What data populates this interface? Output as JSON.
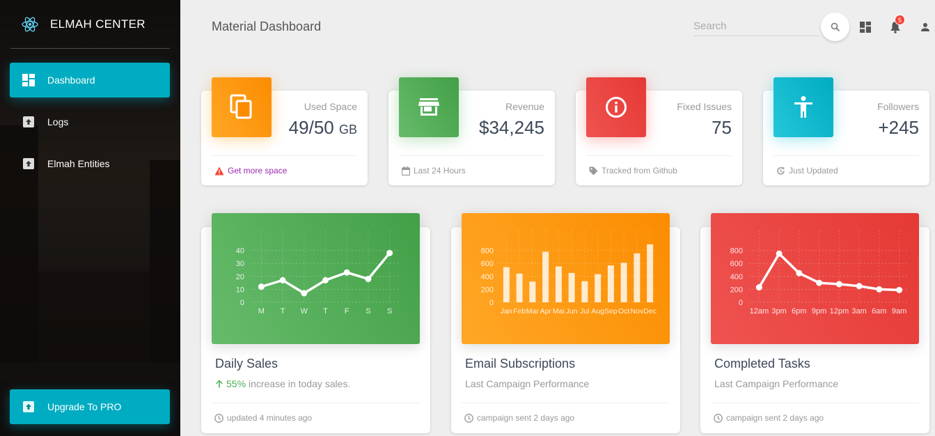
{
  "sidebar": {
    "brand": "ELMAH CENTER",
    "items": [
      {
        "label": "Dashboard",
        "icon": "dashboard-icon"
      },
      {
        "label": "Logs",
        "icon": "upload-box-icon"
      },
      {
        "label": "Elmah Entities",
        "icon": "upload-box-icon"
      }
    ],
    "upgrade_label": "Upgrade To PRO",
    "accent": "#00acc1"
  },
  "topbar": {
    "title": "Material Dashboard",
    "search_placeholder": "Search",
    "notification_count": "5"
  },
  "stats": [
    {
      "category": "Used Space",
      "value": "49/50",
      "unit": "GB",
      "footer": "Get more space",
      "footer_icon": "warning-icon",
      "color": "#fb8c00",
      "icon": "content-copy-icon"
    },
    {
      "category": "Revenue",
      "value": "$34,245",
      "footer": "Last 24 Hours",
      "footer_icon": "calendar-icon",
      "color": "#43a047",
      "icon": "store-icon"
    },
    {
      "category": "Fixed Issues",
      "value": "75",
      "footer": "Tracked from Github",
      "footer_icon": "tag-icon",
      "color": "#e53935",
      "icon": "info-icon"
    },
    {
      "category": "Followers",
      "value": "+245",
      "footer": "Just Updated",
      "footer_icon": "update-icon",
      "color": "#00acc1",
      "icon": "accessibility-icon"
    }
  ],
  "cards": [
    {
      "title": "Daily Sales",
      "subtitle_highlight": "55%",
      "subtitle": "increase in today sales.",
      "footer": "updated 4 minutes ago",
      "color": "#4caf50"
    },
    {
      "title": "Email Subscriptions",
      "subtitle": "Last Campaign Performance",
      "footer": "campaign sent 2 days ago",
      "color": "#ff9800"
    },
    {
      "title": "Completed Tasks",
      "subtitle": "Last Campaign Performance",
      "footer": "campaign sent 2 days ago",
      "color": "#f44336"
    }
  ],
  "chart_data": [
    {
      "type": "line",
      "categories": [
        "M",
        "T",
        "W",
        "T",
        "F",
        "S",
        "S"
      ],
      "values": [
        12,
        17,
        7,
        17,
        23,
        18,
        38
      ],
      "ylim": [
        0,
        50
      ],
      "yticks": [
        0,
        10,
        20,
        30,
        40
      ]
    },
    {
      "type": "bar",
      "categories": [
        "Jan",
        "Feb",
        "Mar",
        "Apr",
        "Mai",
        "Jun",
        "Jul",
        "Aug",
        "Sep",
        "Oct",
        "Nov",
        "Dec"
      ],
      "values": [
        542,
        443,
        320,
        780,
        553,
        453,
        326,
        434,
        568,
        610,
        756,
        895
      ],
      "ylim": [
        0,
        1000
      ],
      "yticks": [
        0,
        200,
        400,
        600,
        800
      ]
    },
    {
      "type": "line",
      "categories": [
        "12am",
        "3pm",
        "6pm",
        "9pm",
        "12pm",
        "3am",
        "6am",
        "9am"
      ],
      "values": [
        230,
        750,
        450,
        300,
        280,
        250,
        200,
        190
      ],
      "ylim": [
        0,
        1000
      ],
      "yticks": [
        0,
        200,
        400,
        600,
        800
      ]
    }
  ]
}
